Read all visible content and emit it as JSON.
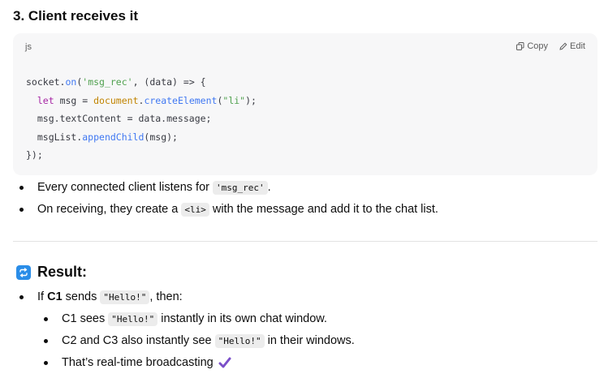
{
  "section_heading": "3. Client receives it",
  "code_block": {
    "language": "js",
    "copy_label": "Copy",
    "edit_label": "Edit",
    "lines": [
      "socket.on('msg_rec', (data) => {",
      "  let msg = document.createElement(\"li\");",
      "  msg.textContent = data.message;",
      "  msgList.appendChild(msg);",
      "});"
    ]
  },
  "bullets": [
    {
      "before": "Every connected client listens for ",
      "code": "'msg_rec'",
      "after": "."
    },
    {
      "before": "On receiving, they create a ",
      "code": "<li>",
      "after": " with the message and add it to the chat list."
    }
  ],
  "result": {
    "heading": "Result:",
    "icon": "repeat-icon",
    "icon_color": "#2a8de8",
    "item": {
      "before": "If ",
      "bold": "C1",
      "middle": " sends ",
      "code": "\"Hello!\"",
      "after": ", then:"
    },
    "sub_items": [
      {
        "before": "C1 sees ",
        "code": "\"Hello!\"",
        "after": " instantly in its own chat window."
      },
      {
        "before": "C2 and C3 also instantly see ",
        "code": "\"Hello!\"",
        "after": " in their windows."
      },
      {
        "before": "That’s real-time broadcasting",
        "code": "",
        "after": ""
      }
    ],
    "check_icon": "check-mark-icon",
    "check_color": "#7b4fc9"
  }
}
